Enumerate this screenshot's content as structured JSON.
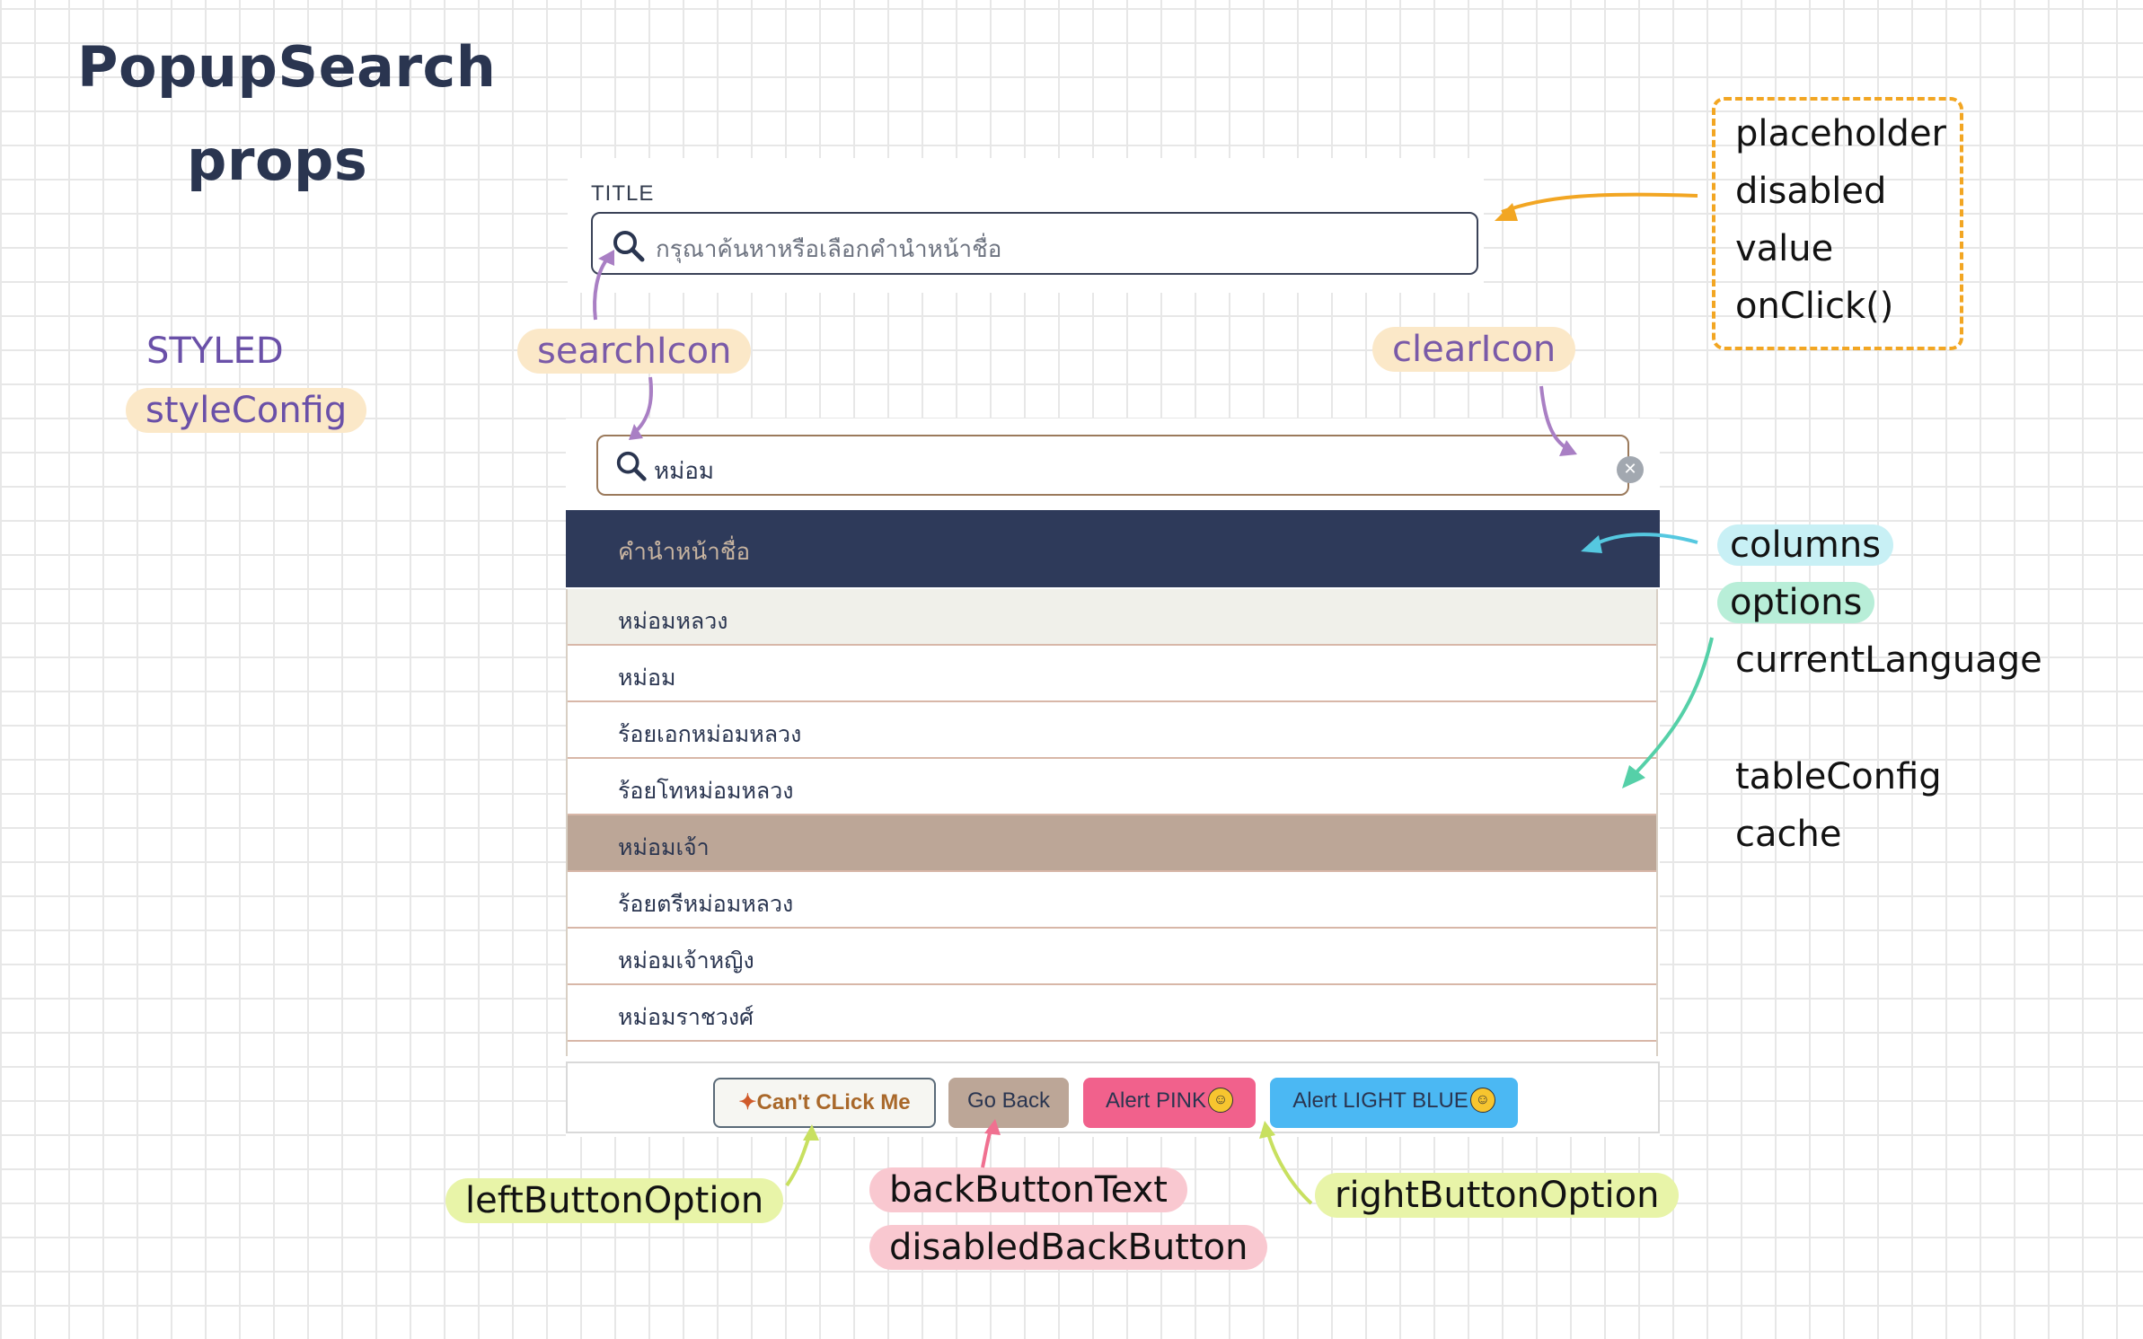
{
  "heading": {
    "line1": "PopupSearch",
    "line2": "props"
  },
  "styled": {
    "label": "STYLED",
    "config": "styleConfig"
  },
  "top_input": {
    "caption": "TITLE",
    "placeholder": "กรุณาค้นหาหรือเลือกคำนำหน้าชื่อ",
    "search_icon": "search-icon"
  },
  "annotations": {
    "search_icon": "searchIcon",
    "clear_icon": "clearIcon",
    "columns": "columns",
    "options": "options",
    "current_language": "currentLanguage",
    "table_config": "tableConfig",
    "cache": "cache",
    "left_button_option": "leftButtonOption",
    "back_button_text": "backButtonText",
    "disabled_back_button": "disabledBackButton",
    "right_button_option": "rightButtonOption"
  },
  "props_box": {
    "items": [
      "placeholder",
      "disabled",
      "value",
      "onClick()"
    ]
  },
  "popup": {
    "search_value": "หม่อม",
    "column_header": "คำนำหน้าชื่อ",
    "rows": [
      "หม่อมหลวง",
      "หม่อม",
      "ร้อยเอกหม่อมหลวง",
      "ร้อยโทหม่อมหลวง",
      "หม่อมเจ้า",
      "ร้อยตรีหม่อมหลวง",
      "หม่อมเจ้าหญิง",
      "หม่อมราชวงศ์"
    ],
    "selected_row": "หม่อมเจ้า",
    "buttons": {
      "left": "Can't CLick Me",
      "back": "Go Back",
      "pink": "Alert PINK",
      "blue": "Alert LIGHT BLUE"
    }
  },
  "colors": {
    "header_bg": "#2e3a5a",
    "selected_row": "#bca697",
    "pink_button": "#f1618c",
    "blue_button": "#4bb8f3",
    "props_box_border": "#f2a623"
  }
}
